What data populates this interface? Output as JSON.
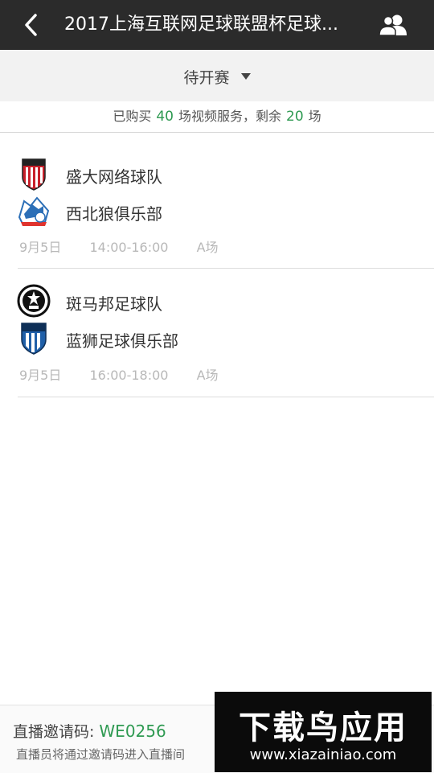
{
  "header": {
    "back_icon": "chevron-left-icon",
    "title": "2017上海互联网足球联盟杯足球...",
    "users_icon": "users-icon"
  },
  "filter": {
    "label": "待开赛",
    "icon": "caret-down-icon"
  },
  "service": {
    "prefix": "已购买",
    "bought": "40",
    "middle": "场视频服务，剩余",
    "remaining": "20",
    "suffix": "场"
  },
  "matches": [
    {
      "home": {
        "name": "盛大网络球队",
        "logo_color": "#c8202a"
      },
      "away": {
        "name": "西北狼俱乐部",
        "logo_color": "#2c6fb7"
      },
      "date": "9月5日",
      "time": "14:00-16:00",
      "field": "A场"
    },
    {
      "home": {
        "name": "斑马邦足球队",
        "logo_color": "#111111"
      },
      "away": {
        "name": "蓝狮足球俱乐部",
        "logo_color": "#1f5fa8"
      },
      "date": "9月5日",
      "time": "16:00-18:00",
      "field": "A场"
    }
  ],
  "footer": {
    "code_label": "直播邀请码:",
    "code": "WE0256",
    "hint": "直播员将通过邀请码进入直播间"
  },
  "watermark": {
    "logo": "下载鸟应用",
    "url": "www.xiazainiao.com"
  }
}
